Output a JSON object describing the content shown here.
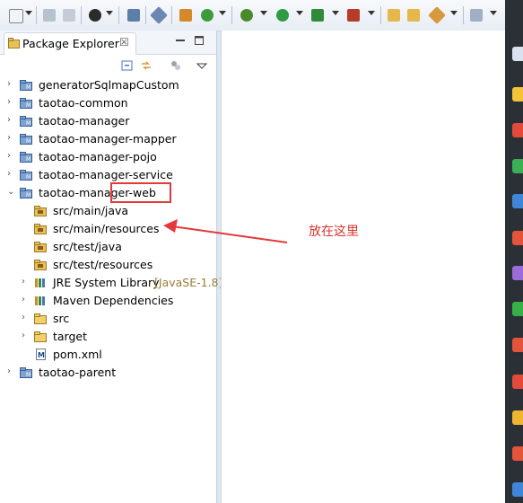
{
  "window": {
    "panel_title": "Package Explorer",
    "close_glyph": "☒"
  },
  "tree": {
    "items": [
      {
        "label": "generatorSqlmapCustom",
        "indent": 0,
        "expanded": false,
        "icon": "project-icon"
      },
      {
        "label": "taotao-common",
        "indent": 0,
        "expanded": false,
        "icon": "project-icon"
      },
      {
        "label": "taotao-manager",
        "indent": 0,
        "expanded": false,
        "icon": "project-icon"
      },
      {
        "label": "taotao-manager-mapper",
        "indent": 0,
        "expanded": false,
        "icon": "project-icon"
      },
      {
        "label": "taotao-manager-pojo",
        "indent": 0,
        "expanded": false,
        "icon": "project-icon"
      },
      {
        "label": "taotao-manager-service",
        "indent": 0,
        "expanded": false,
        "icon": "project-icon"
      },
      {
        "label": "taotao-manager-web",
        "indent": 0,
        "expanded": true,
        "icon": "project-icon"
      },
      {
        "label": "src/main/java",
        "indent": 1,
        "expanded": null,
        "icon": "source-folder-icon"
      },
      {
        "label": "src/main/resources",
        "indent": 1,
        "expanded": null,
        "icon": "source-folder-icon"
      },
      {
        "label": "src/test/java",
        "indent": 1,
        "expanded": null,
        "icon": "source-folder-icon"
      },
      {
        "label": "src/test/resources",
        "indent": 1,
        "expanded": null,
        "icon": "source-folder-icon"
      },
      {
        "label": "JRE System Library",
        "decoration": "[JavaSE-1.8]",
        "indent": 1,
        "expanded": false,
        "icon": "library-icon"
      },
      {
        "label": "Maven Dependencies",
        "indent": 1,
        "expanded": false,
        "icon": "library-icon"
      },
      {
        "label": "src",
        "indent": 1,
        "expanded": false,
        "icon": "folder-icon"
      },
      {
        "label": "target",
        "indent": 1,
        "expanded": false,
        "icon": "folder-icon"
      },
      {
        "label": "pom.xml",
        "indent": 1,
        "expanded": null,
        "icon": "maven-file-icon"
      },
      {
        "label": "taotao-parent",
        "indent": 0,
        "expanded": false,
        "icon": "project-icon"
      }
    ]
  },
  "annotation": {
    "text": "放在这里",
    "color": "#e23a3a"
  },
  "colors": {
    "folder": "#e8c05a",
    "accent": "#4a76b8",
    "highlight": "#e23a3a"
  }
}
